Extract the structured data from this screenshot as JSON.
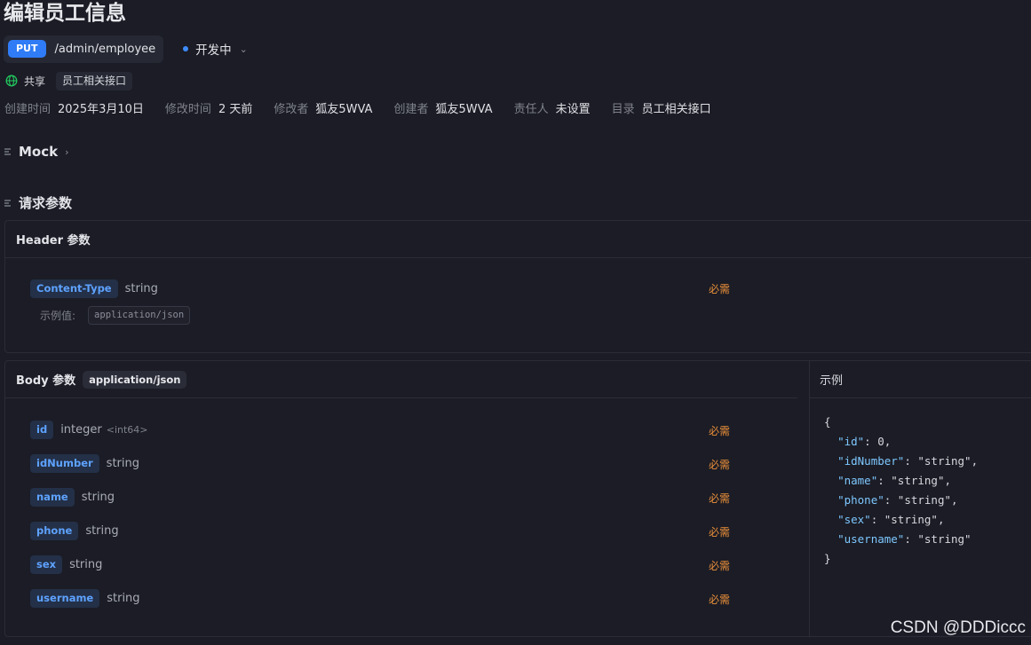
{
  "page_title": "编辑员工信息",
  "endpoint": {
    "method": "PUT",
    "path": "/admin/employee",
    "status": "开发中"
  },
  "share": {
    "label": "共享",
    "folder": "员工相关接口"
  },
  "meta": [
    {
      "key": "创建时间",
      "value": "2025年3月10日"
    },
    {
      "key": "修改时间",
      "value": "2 天前"
    },
    {
      "key": "修改者",
      "value": "狐友5WVA"
    },
    {
      "key": "创建者",
      "value": "狐友5WVA"
    },
    {
      "key": "责任人",
      "value": "未设置"
    },
    {
      "key": "目录",
      "value": "员工相关接口"
    }
  ],
  "sections": {
    "mock": "Mock",
    "request_params": "请求参数"
  },
  "header_params": {
    "title": "Header 参数",
    "items": [
      {
        "name": "Content-Type",
        "type": "string",
        "required": "必需",
        "example_label": "示例值:",
        "example": "application/json"
      }
    ]
  },
  "body_params": {
    "title": "Body 参数",
    "content_type": "application/json",
    "items": [
      {
        "name": "id",
        "type": "integer",
        "format": "<int64>",
        "required": "必需"
      },
      {
        "name": "idNumber",
        "type": "string",
        "format": "",
        "required": "必需"
      },
      {
        "name": "name",
        "type": "string",
        "format": "",
        "required": "必需"
      },
      {
        "name": "phone",
        "type": "string",
        "format": "",
        "required": "必需"
      },
      {
        "name": "sex",
        "type": "string",
        "format": "",
        "required": "必需"
      },
      {
        "name": "username",
        "type": "string",
        "format": "",
        "required": "必需"
      }
    ]
  },
  "example": {
    "title": "示例",
    "lines": [
      "{",
      "  \"id\": 0,",
      "  \"idNumber\": \"string\",",
      "  \"name\": \"string\",",
      "  \"phone\": \"string\",",
      "  \"sex\": \"string\",",
      "  \"username\": \"string\"",
      "}"
    ]
  },
  "watermark": "CSDN @DDDiccc",
  "colors": {
    "accent": "#2f7cf6",
    "required": "#ea8f3a",
    "field_name": "#5ea2ff",
    "background": "#1b1c25"
  }
}
